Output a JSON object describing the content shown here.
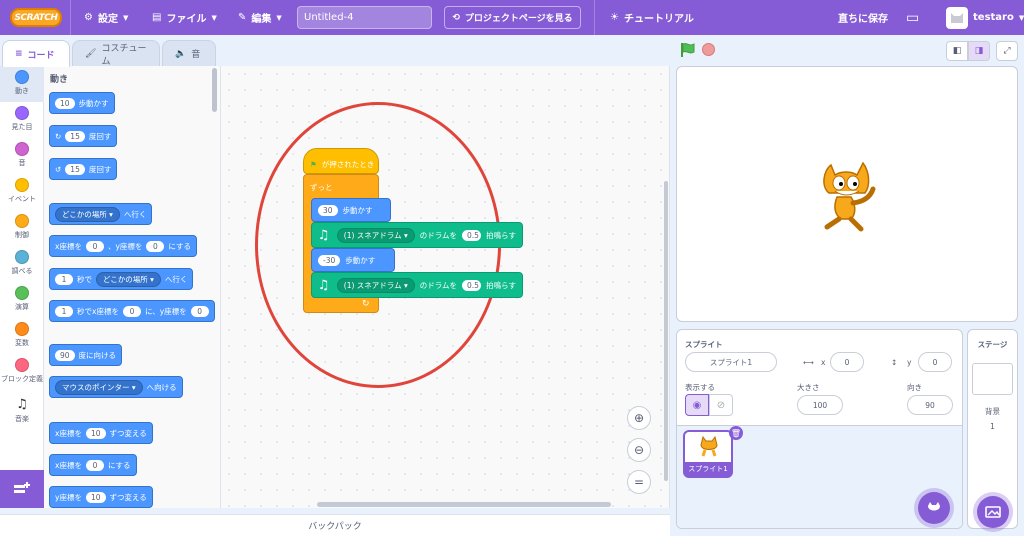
{
  "menubar": {
    "logo": "SCRATCH",
    "settings": "設定",
    "file": "ファイル",
    "edit": "編集",
    "project_title": "Untitled-4",
    "project_page": "プロジェクトページを見る",
    "tutorial": "チュートリアル",
    "save_now": "直ちに保存",
    "username": "testaro"
  },
  "tabs": {
    "code": "コード",
    "costume": "コスチューム",
    "sound": "音"
  },
  "categories": [
    {
      "label": "動き",
      "color": "#4c97ff"
    },
    {
      "label": "見た目",
      "color": "#9966ff"
    },
    {
      "label": "音",
      "color": "#cf63cf"
    },
    {
      "label": "イベント",
      "color": "#ffbf00"
    },
    {
      "label": "制御",
      "color": "#ffab19"
    },
    {
      "label": "調べる",
      "color": "#5cb1d6"
    },
    {
      "label": "演算",
      "color": "#59c059"
    },
    {
      "label": "変数",
      "color": "#ff8c1a"
    },
    {
      "label": "ブロック定義",
      "color": "#ff6680"
    },
    {
      "label": "音楽",
      "color": ""
    }
  ],
  "palette": {
    "heading": "動き",
    "move": {
      "val": "10",
      "text": "歩動かす"
    },
    "turn_right": {
      "val": "15",
      "text": "度回す"
    },
    "turn_left": {
      "val": "15",
      "text": "度回す"
    },
    "goto": {
      "dd": "どこかの場所",
      "text": "へ行く"
    },
    "gotoxy": {
      "a": "x座標を",
      "x": "0",
      "b": "、y座標を",
      "y": "0",
      "c": "にする"
    },
    "glide": {
      "val": "1",
      "a": "秒で",
      "dd": "どこかの場所",
      "b": "へ行く"
    },
    "glidexy": {
      "val": "1",
      "a": "秒でx座標を",
      "x": "0",
      "b": "に、y座標を",
      "y": "0"
    },
    "point": {
      "val": "90",
      "text": "度に向ける"
    },
    "pointto": {
      "dd": "マウスのポインター",
      "text": "へ向ける"
    },
    "changex": {
      "a": "x座標を",
      "val": "10",
      "b": "ずつ変える"
    },
    "setx": {
      "a": "x座標を",
      "val": "0",
      "b": "にする"
    },
    "changey": {
      "a": "y座標を",
      "val": "10",
      "b": "ずつ変える"
    }
  },
  "script": {
    "hat": "が押されたとき",
    "forever": "ずっと",
    "move1": {
      "val": "30",
      "text": "歩動かす"
    },
    "drum1": {
      "dd": "(1) スネアドラム",
      "a": "のドラムを",
      "val": "0.5",
      "b": "拍鳴らす"
    },
    "move2": {
      "val": "-30",
      "text": "歩動かす"
    },
    "drum2": {
      "dd": "(1) スネアドラム",
      "a": "のドラムを",
      "val": "0.5",
      "b": "拍鳴らす"
    }
  },
  "backpack": "バックパック",
  "sprite_info": {
    "sprite_label": "スプライト",
    "sprite_name": "スプライト1",
    "x_label": "x",
    "x": "0",
    "y_label": "y",
    "y": "0",
    "show_label": "表示する",
    "size_label": "大きさ",
    "size": "100",
    "direction_label": "向き",
    "direction": "90"
  },
  "sprites": [
    {
      "name": "スプライト1"
    }
  ],
  "stage_pane": {
    "title": "ステージ",
    "backdrop_label": "背景",
    "backdrop_count": "1"
  }
}
